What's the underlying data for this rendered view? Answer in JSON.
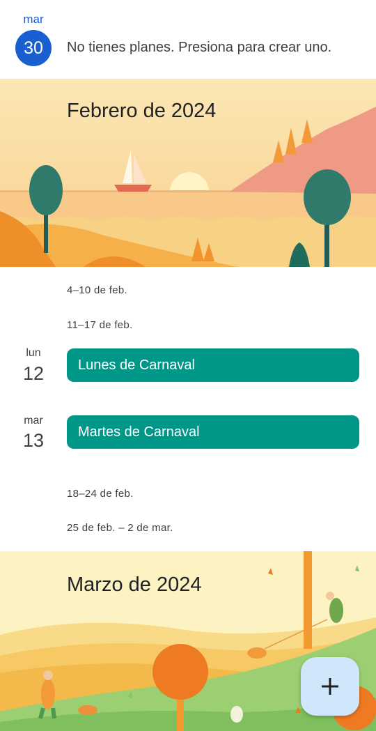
{
  "today": {
    "dow": "mar",
    "day": "30",
    "message": "No tienes planes. Presiona para crear uno."
  },
  "february": {
    "title": "Febrero de 2024",
    "weeks": [
      "4–10 de feb.",
      "11–17 de feb.",
      "18–24 de feb.",
      "25 de feb. – 2 de mar."
    ],
    "days": [
      {
        "dow": "lun",
        "day": "12",
        "event": "Lunes de Carnaval",
        "color": "#009688"
      },
      {
        "dow": "mar",
        "day": "13",
        "event": "Martes de Carnaval",
        "color": "#009688"
      }
    ]
  },
  "march": {
    "title": "Marzo de 2024"
  },
  "fab": {
    "icon": "plus-icon"
  },
  "colors": {
    "today_accent": "#1a5fd0",
    "event": "#009688",
    "fab_bg": "#cfe6fb"
  }
}
